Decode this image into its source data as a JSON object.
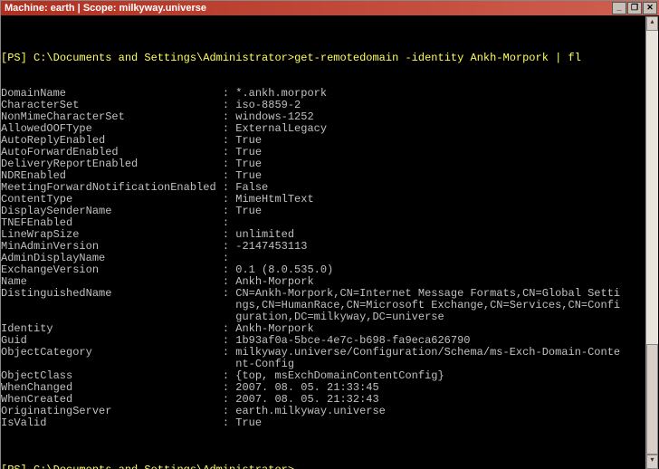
{
  "title": "Machine: earth | Scope: milkyway.universe",
  "prompt_tag": "[PS]",
  "prompt_path": " C:\\Documents and Settings\\Administrator>",
  "command": "get-remotedomain -identity Ankh-Morpork | fl",
  "key_col_width": 34,
  "props": [
    {
      "k": "DomainName",
      "v": "*.ankh.morpork"
    },
    {
      "k": "CharacterSet",
      "v": "iso-8859-2"
    },
    {
      "k": "NonMimeCharacterSet",
      "v": "windows-1252"
    },
    {
      "k": "AllowedOOFType",
      "v": "ExternalLegacy"
    },
    {
      "k": "AutoReplyEnabled",
      "v": "True"
    },
    {
      "k": "AutoForwardEnabled",
      "v": "True"
    },
    {
      "k": "DeliveryReportEnabled",
      "v": "True"
    },
    {
      "k": "NDREnabled",
      "v": "True"
    },
    {
      "k": "MeetingForwardNotificationEnabled",
      "v": "False"
    },
    {
      "k": "ContentType",
      "v": "MimeHtmlText"
    },
    {
      "k": "DisplaySenderName",
      "v": "True"
    },
    {
      "k": "TNEFEnabled",
      "v": ""
    },
    {
      "k": "LineWrapSize",
      "v": "unlimited"
    },
    {
      "k": "MinAdminVersion",
      "v": "-2147453113"
    },
    {
      "k": "AdminDisplayName",
      "v": ""
    },
    {
      "k": "ExchangeVersion",
      "v": "0.1 (8.0.535.0)"
    },
    {
      "k": "Name",
      "v": "Ankh-Morpork"
    },
    {
      "k": "DistinguishedName",
      "v": "CN=Ankh-Morpork,CN=Internet Message Formats,CN=Global Settings,CN=HumanRace,CN=Microsoft Exchange,CN=Services,CN=Configuration,DC=milkyway,DC=universe"
    },
    {
      "k": "Identity",
      "v": "Ankh-Morpork"
    },
    {
      "k": "Guid",
      "v": "1b93af0a-5bce-4e7c-b698-fa9eca626790"
    },
    {
      "k": "ObjectCategory",
      "v": "milkyway.universe/Configuration/Schema/ms-Exch-Domain-Content-Config"
    },
    {
      "k": "ObjectClass",
      "v": "{top, msExchDomainContentConfig}"
    },
    {
      "k": "WhenChanged",
      "v": "2007. 08. 05. 21:33:45"
    },
    {
      "k": "WhenCreated",
      "v": "2007. 08. 05. 21:32:43"
    },
    {
      "k": "OriginatingServer",
      "v": "earth.milkyway.universe"
    },
    {
      "k": "IsValid",
      "v": "True"
    }
  ],
  "console_cols": 95
}
